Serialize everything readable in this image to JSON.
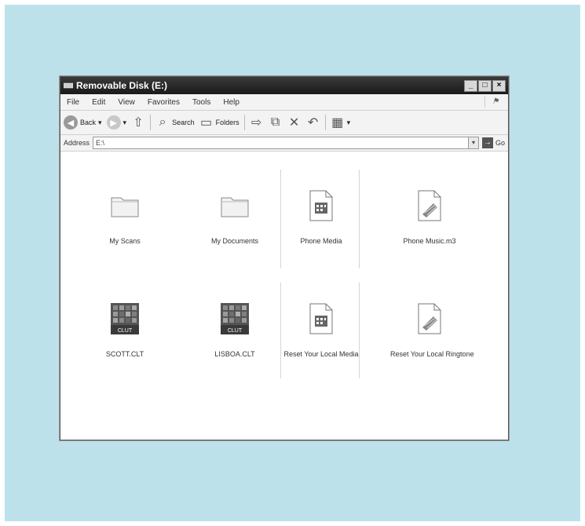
{
  "window": {
    "title": "Removable Disk (E:)",
    "controls": [
      "_",
      "□",
      "×"
    ]
  },
  "menu": {
    "items": [
      "File",
      "Edit",
      "View",
      "Favorites",
      "Tools",
      "Help"
    ]
  },
  "toolbar": {
    "back_label": "Back",
    "search_label": "Search",
    "folders_label": "Folders"
  },
  "address": {
    "label": "Address",
    "value": "E:\\",
    "go_label": "Go"
  },
  "files": [
    {
      "name": "My Scans",
      "type": "folder"
    },
    {
      "name": "My Documents",
      "type": "folder"
    },
    {
      "name": "Phone Media",
      "type": "media"
    },
    {
      "name": "Phone Music.m3",
      "type": "music"
    },
    {
      "name": "SCOTT.CLT",
      "type": "clut"
    },
    {
      "name": "LISBOA.CLT",
      "type": "clut"
    },
    {
      "name": "Reset Your Local Media",
      "type": "media"
    },
    {
      "name": "Reset Your Local Ringtone",
      "type": "music"
    }
  ]
}
